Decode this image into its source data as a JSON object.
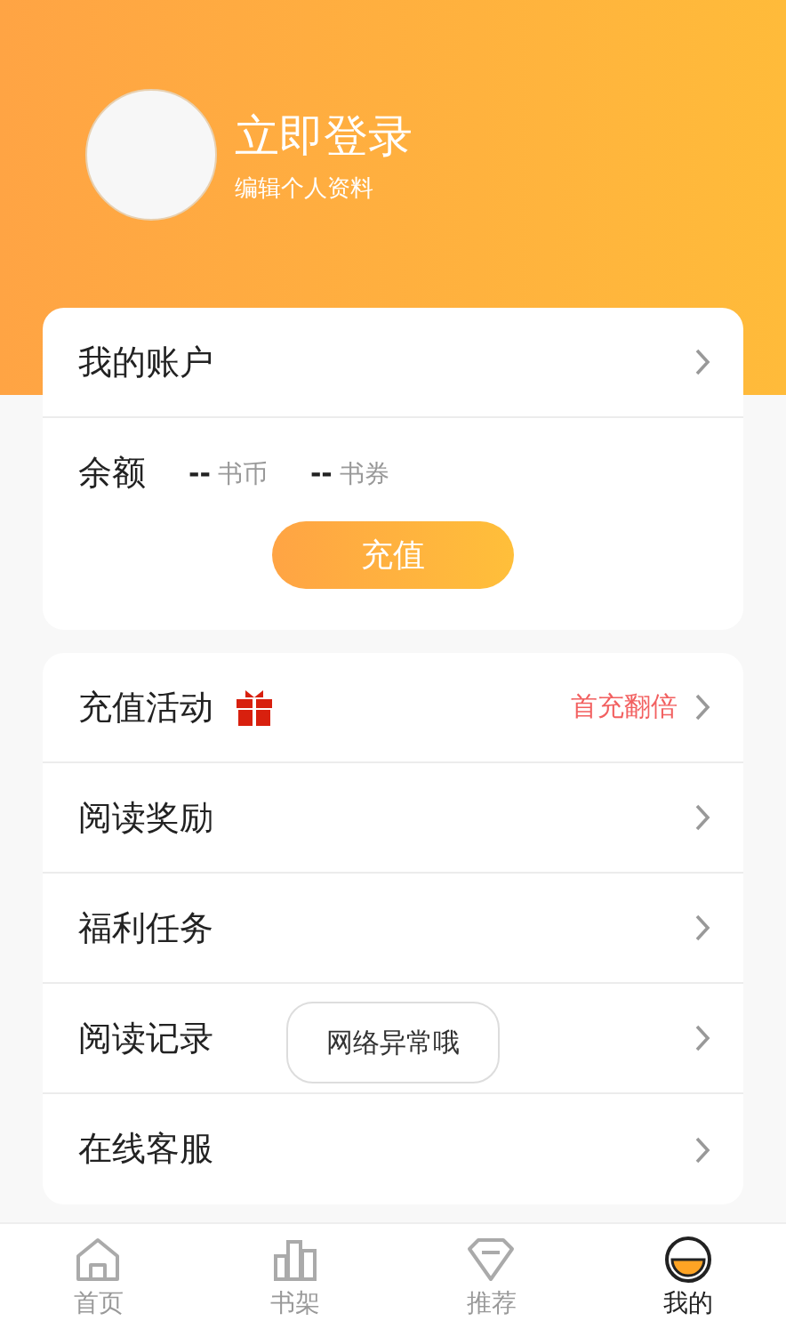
{
  "profile": {
    "title": "立即登录",
    "subtitle": "编辑个人资料"
  },
  "account": {
    "title": "我的账户",
    "balance_label": "余额",
    "balances": [
      {
        "value": "--",
        "unit": "书币"
      },
      {
        "value": "--",
        "unit": "书券"
      }
    ],
    "recharge_button": "充值"
  },
  "menu": [
    {
      "label": "充值活动",
      "kind": "gift",
      "badge": "首充翻倍"
    },
    {
      "label": "阅读奖励",
      "kind": "plain"
    },
    {
      "label": "福利任务",
      "kind": "plain"
    },
    {
      "label": "阅读记录",
      "kind": "plain"
    },
    {
      "label": "在线客服",
      "kind": "plain"
    }
  ],
  "toast": "网络异常哦",
  "tabs": [
    {
      "label": "首页",
      "kind": "home",
      "selected": false
    },
    {
      "label": "书架",
      "kind": "shelf",
      "selected": false
    },
    {
      "label": "推荐",
      "kind": "gem",
      "selected": false
    },
    {
      "label": "我的",
      "kind": "me",
      "selected": true
    }
  ]
}
